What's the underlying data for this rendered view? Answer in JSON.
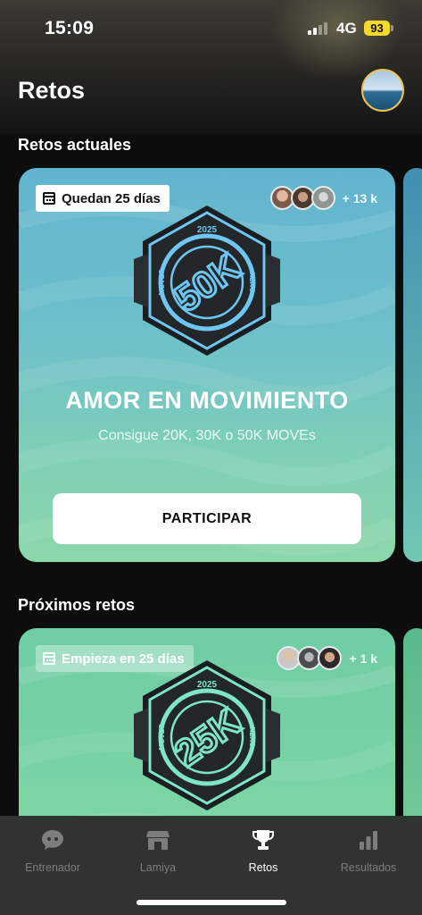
{
  "status": {
    "time": "15:09",
    "network": "4G",
    "battery": "93"
  },
  "header": {
    "title": "Retos"
  },
  "sections": {
    "current_title": "Retos actuales",
    "upcoming_title": "Próximos retos"
  },
  "current_challenge": {
    "date_label": "Quedan 25 días",
    "participants_extra": "+ 13 k",
    "badge": {
      "year": "2025",
      "distance": "50K",
      "left_word": "MOVES",
      "right_word": "HERO",
      "accent": "#6ec6f2"
    },
    "title": "AMOR EN MOVIMIENTO",
    "subtitle": "Consigue 20K, 30K o 50K MOVEs",
    "button_label": "PARTICIPAR"
  },
  "upcoming_challenge": {
    "date_label": "Empieza en 25 días",
    "participants_extra": "+ 1 k",
    "badge": {
      "year": "2025",
      "distance": "25K",
      "left_word": "MOVES",
      "right_word": "HERO",
      "accent": "#7ee6c4"
    }
  },
  "tabs": [
    {
      "label": "Entrenador",
      "icon": "chat-bubble-icon",
      "active": false
    },
    {
      "label": "Lamiya",
      "icon": "store-icon",
      "active": false
    },
    {
      "label": "Retos",
      "icon": "trophy-icon",
      "active": true
    },
    {
      "label": "Resultados",
      "icon": "bar-chart-icon",
      "active": false
    }
  ],
  "colors": {
    "current_card": "#6cbfcb",
    "upcoming_card": "#78d3a4",
    "tab_bar": "#2f3431",
    "battery": "#f3d92b"
  }
}
